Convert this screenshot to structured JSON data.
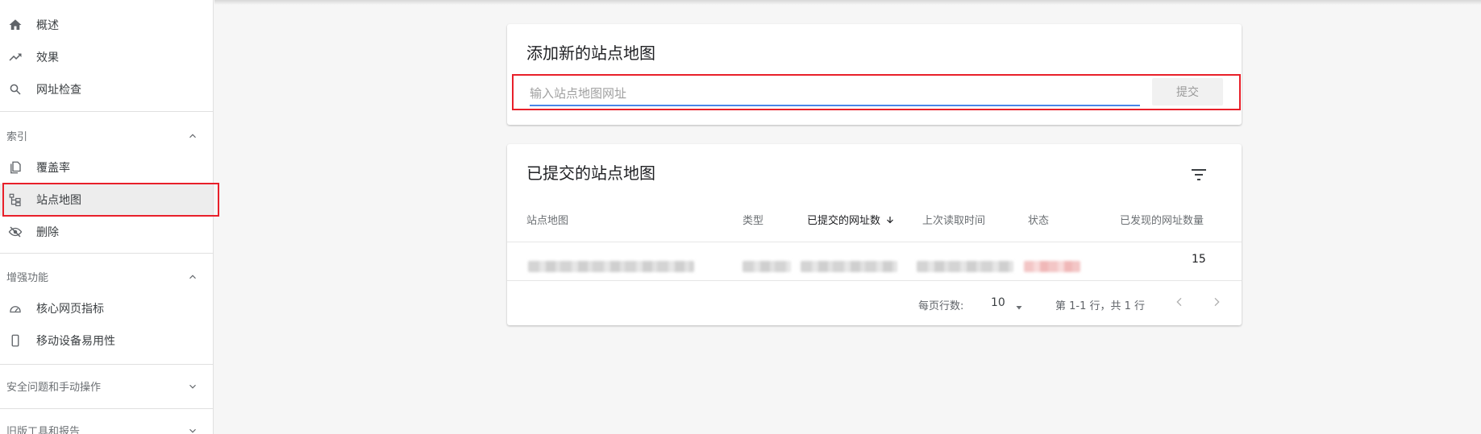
{
  "sidebar": {
    "items_top": [
      {
        "label": "概述",
        "icon": "home-icon"
      },
      {
        "label": "效果",
        "icon": "trending-up-icon"
      },
      {
        "label": "网址检查",
        "icon": "search-icon"
      }
    ],
    "sections": [
      {
        "title": "索引",
        "expanded": true,
        "items": [
          {
            "label": "覆盖率",
            "icon": "copy-pages-icon"
          },
          {
            "label": "站点地图",
            "icon": "sitemap-icon",
            "active": true
          },
          {
            "label": "删除",
            "icon": "eye-off-icon"
          }
        ]
      },
      {
        "title": "增强功能",
        "expanded": true,
        "items": [
          {
            "label": "核心网页指标",
            "icon": "speedometer-icon"
          },
          {
            "label": "移动设备易用性",
            "icon": "smartphone-icon"
          }
        ]
      },
      {
        "title": "安全问题和手动操作",
        "expanded": false
      },
      {
        "title": "旧版工具和报告",
        "expanded": false
      }
    ]
  },
  "add_card": {
    "title": "添加新的站点地图",
    "input_placeholder": "输入站点地图网址",
    "input_value": "",
    "submit_label": "提交"
  },
  "submitted_card": {
    "title": "已提交的站点地图",
    "columns": [
      "站点地图",
      "类型",
      "已提交的网址数",
      "上次读取时间",
      "状态",
      "已发现的网址数量"
    ],
    "sorted_column": "已提交的网址数",
    "rows": [
      {
        "discovered_urls": "15"
      }
    ],
    "footer": {
      "rows_per_page_label": "每页行数:",
      "rows_per_page_value": "10",
      "range_text": "第 1-1 行，共 1 行"
    }
  },
  "colors": {
    "highlight": "#e8202a",
    "input_underline": "#4a86e8",
    "active_bg": "#ededed"
  }
}
